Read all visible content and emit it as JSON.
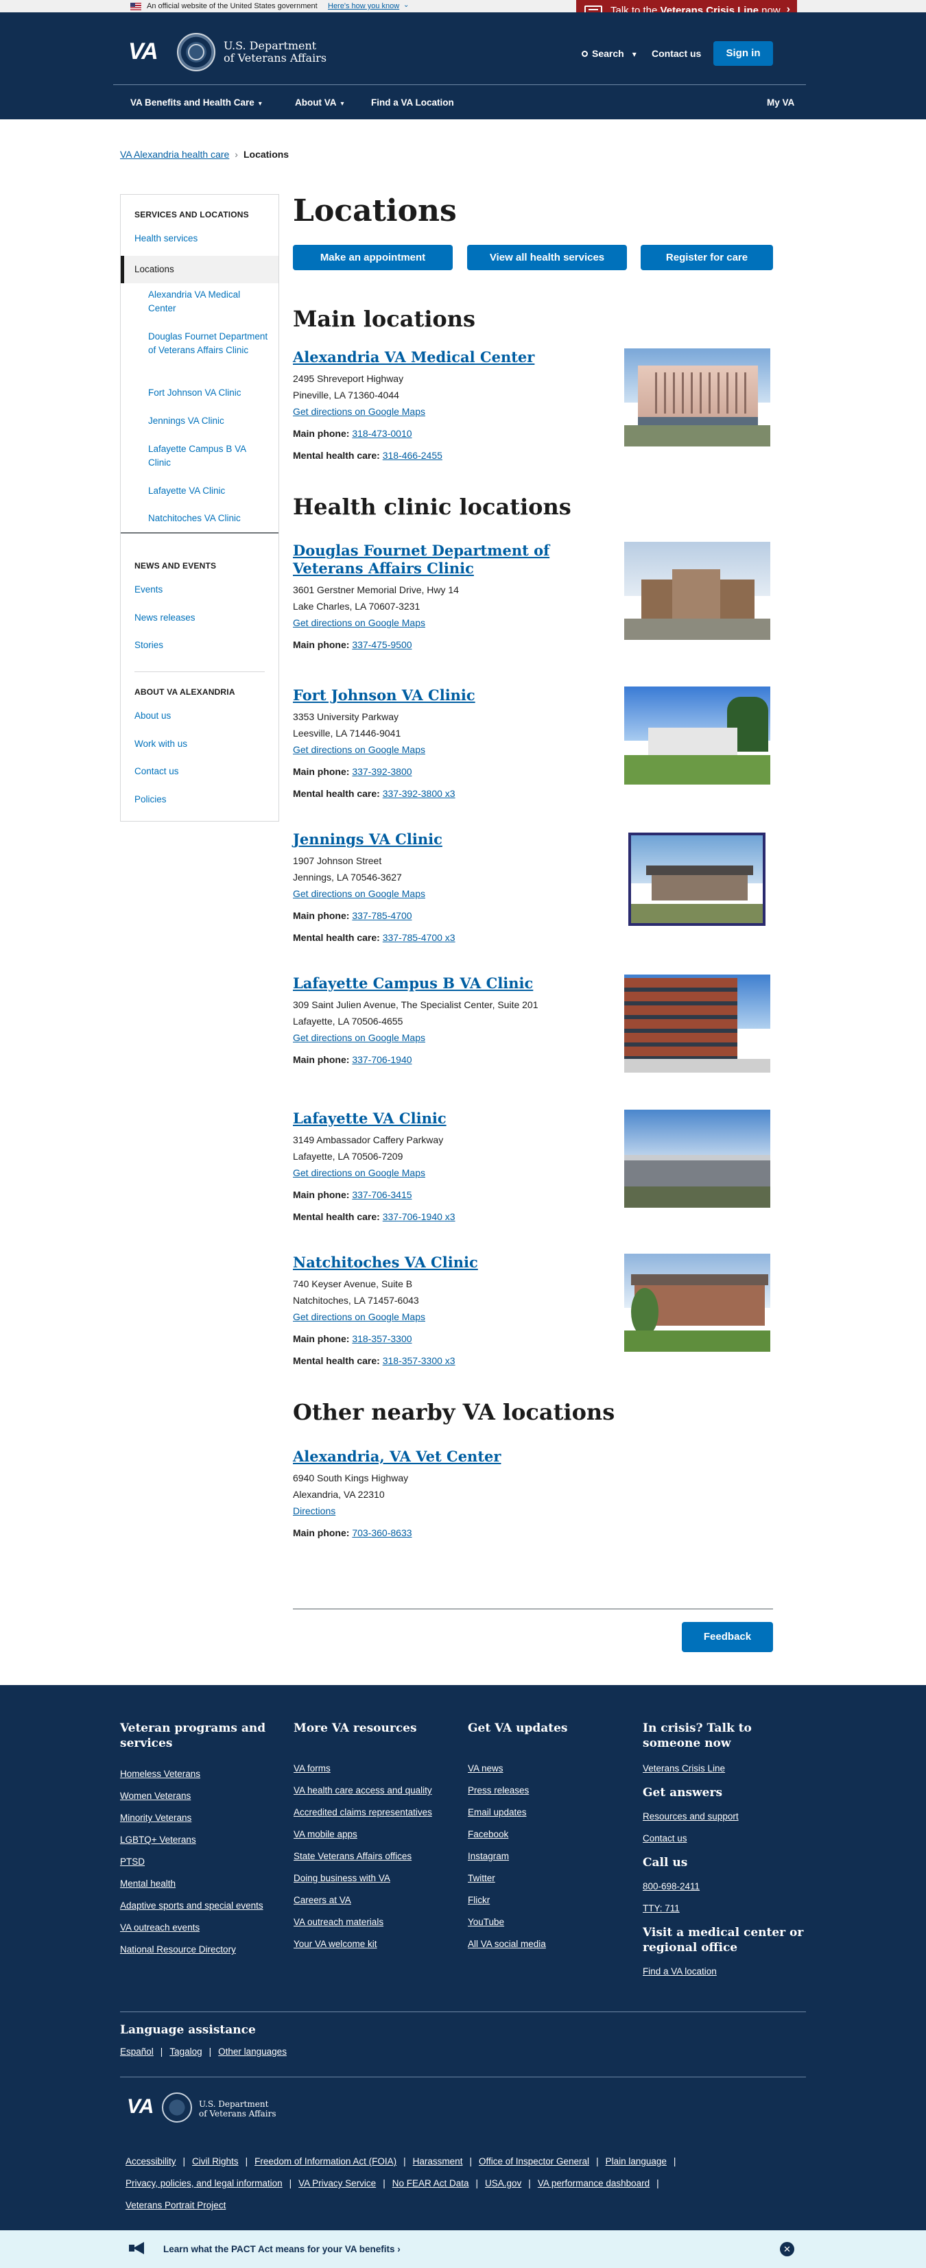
{
  "official_banner": {
    "text": "An official website of the United States government",
    "how_link": "Here's how you know"
  },
  "crisis": {
    "prefix": "Talk to the ",
    "bold": "Veterans Crisis Line",
    "suffix": " now"
  },
  "header": {
    "logo": "VA",
    "dept_line1": "U.S. Department",
    "dept_line2": "of Veterans Affairs",
    "search": "Search",
    "contact": "Contact us",
    "signin": "Sign in",
    "nav": [
      "VA Benefits and Health Care",
      "About VA",
      "Find a VA Location",
      "My VA"
    ]
  },
  "breadcrumb": {
    "parent": "VA Alexandria health care",
    "current": "Locations"
  },
  "sidebar": {
    "heading1": "Services and locations",
    "health_services": "Health services",
    "locations": "Locations",
    "sub": [
      "Alexandria VA Medical Center",
      "Douglas Fournet Department of Veterans Affairs Clinic",
      "Fort Johnson VA Clinic",
      "Jennings VA Clinic",
      "Lafayette Campus B VA Clinic",
      "Lafayette VA Clinic",
      "Natchitoches VA Clinic"
    ],
    "heading2": "News and events",
    "news": [
      "Events",
      "News releases",
      "Stories"
    ],
    "heading3": "About VA Alexandria",
    "about": [
      "About us",
      "Work with us",
      "Contact us",
      "Policies"
    ]
  },
  "main": {
    "title": "Locations",
    "buttons": [
      "Make an appointment",
      "View all health services",
      "Register for care"
    ],
    "main_heading": "Main locations",
    "clinic_heading": "Health clinic locations",
    "other_heading": "Other nearby VA locations",
    "directions_label": "Get directions on Google Maps",
    "main_phone_label": "Main phone:",
    "mental_label": "Mental health care:",
    "main_locations": [
      {
        "name": "Alexandria VA Medical Center",
        "address1": "2495 Shreveport Highway",
        "address2": "Pineville, LA 71360-4044",
        "phone": "318-473-0010",
        "mental": "318-466-2455"
      }
    ],
    "clinics": [
      {
        "name": "Douglas Fournet Department of Veterans Affairs Clinic",
        "address1": "3601 Gerstner Memorial Drive, Hwy 14",
        "address2": "Lake Charles, LA 70607-3231",
        "phone": "337-475-9500"
      },
      {
        "name": "Fort Johnson VA Clinic",
        "address1": "3353 University Parkway",
        "address2": "Leesville, LA 71446-9041",
        "phone": "337-392-3800",
        "mental": "337-392-3800 x3"
      },
      {
        "name": "Jennings VA Clinic",
        "address1": "1907 Johnson Street",
        "address2": "Jennings, LA 70546-3627",
        "phone": "337-785-4700",
        "mental": "337-785-4700 x3"
      },
      {
        "name": "Lafayette Campus B VA Clinic",
        "address1": "309 Saint Julien Avenue, The Specialist Center, Suite 201",
        "address2": "Lafayette, LA 70506-4655",
        "phone": "337-706-1940"
      },
      {
        "name": "Lafayette VA Clinic",
        "address1": "3149 Ambassador Caffery Parkway",
        "address2": "Lafayette, LA 70506-7209",
        "phone": "337-706-3415",
        "mental": "337-706-1940 x3"
      },
      {
        "name": "Natchitoches VA Clinic",
        "address1": "740 Keyser Avenue, Suite B",
        "address2": "Natchitoches, LA 71457-6043",
        "phone": "318-357-3300",
        "mental": "318-357-3300 x3"
      }
    ],
    "other": {
      "name": "Alexandria, VA Vet Center",
      "address1": "6940 South Kings Highway",
      "address2": "Alexandria, VA 22310",
      "directions": "Directions",
      "phone": "703-360-8633"
    },
    "feedback": "Feedback"
  },
  "footer": {
    "col1_title": "Veteran programs and services",
    "col1": [
      "Homeless Veterans",
      "Women Veterans",
      "Minority Veterans",
      "LGBTQ+ Veterans",
      "PTSD",
      "Mental health",
      "Adaptive sports and special events",
      "VA outreach events",
      "National Resource Directory"
    ],
    "col2_title": "More VA resources",
    "col2": [
      "VA forms",
      "VA health care access and quality",
      "Accredited claims representatives",
      "VA mobile apps",
      "State Veterans Affairs offices",
      "Doing business with VA",
      "Careers at VA",
      "VA outreach materials",
      "Your VA welcome kit"
    ],
    "col3_title": "Get VA updates",
    "col3": [
      "VA news",
      "Press releases",
      "Email updates",
      "Facebook",
      "Instagram",
      "Twitter",
      "Flickr",
      "YouTube",
      "All VA social media"
    ],
    "col4_title": "In crisis? Talk to someone now",
    "col4_crisis": "Veterans Crisis Line",
    "answers_title": "Get answers",
    "answers": [
      "Resources and support",
      "Contact us"
    ],
    "call_title": "Call us",
    "call": [
      "800-698-2411",
      "TTY: 711"
    ],
    "visit_title": "Visit a medical center or regional office",
    "visit": "Find a VA location",
    "lang_title": "Language assistance",
    "langs": [
      "Español",
      "Tagalog",
      "Other languages"
    ],
    "logo": "VA",
    "dept_line1": "U.S. Department",
    "dept_line2": "of Veterans Affairs",
    "legal_row1": [
      "Accessibility",
      "Civil Rights",
      "Freedom of Information Act (FOIA)",
      "Harassment",
      "Office of Inspector General",
      "Plain language"
    ],
    "legal_row2": [
      "Privacy, policies, and legal information",
      "VA Privacy Service",
      "No FEAR Act Data",
      "USA.gov",
      "VA performance dashboard"
    ],
    "legal_row3": [
      "Veterans Portrait Project"
    ]
  },
  "pact_banner": {
    "text": "Learn what the PACT Act means for your VA benefits ›"
  }
}
